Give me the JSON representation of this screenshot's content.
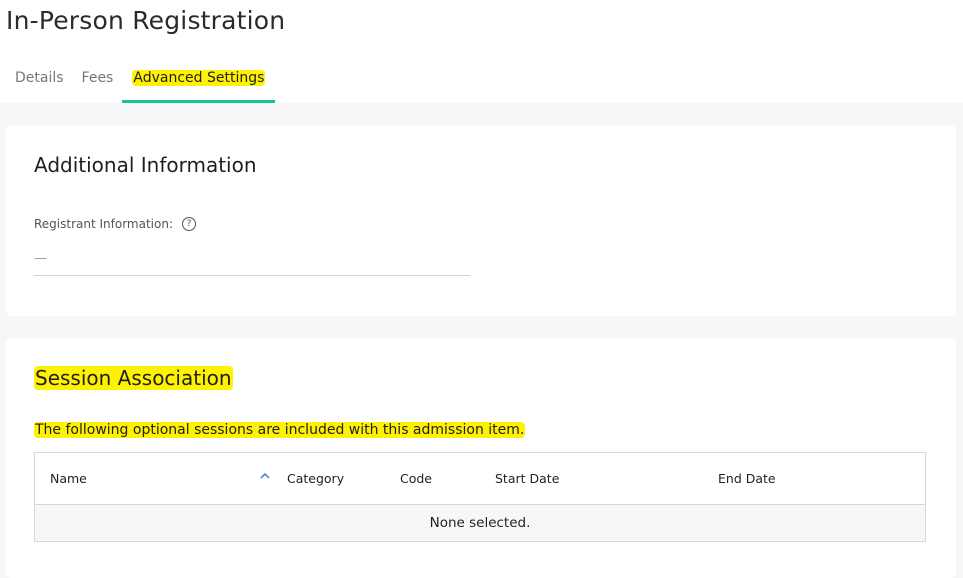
{
  "page": {
    "title": "In-Person Registration"
  },
  "tabs": [
    {
      "label": "Details"
    },
    {
      "label": "Fees"
    },
    {
      "label": "Advanced Settings"
    }
  ],
  "additional_info": {
    "title": "Additional Information",
    "field_label": "Registrant Information:",
    "field_value": "—",
    "help_icon": "help-icon"
  },
  "session_association": {
    "title": "Session Association",
    "description": "The following optional sessions are included with this admission item.",
    "columns": [
      "Name",
      "Category",
      "Code",
      "Start Date",
      "End Date"
    ],
    "sort_icon": "chevron-up-icon",
    "empty_text": "None selected."
  },
  "colors": {
    "accent": "#1bbf9a",
    "highlight": "#fff200",
    "sort_icon": "#3b7bd4"
  }
}
